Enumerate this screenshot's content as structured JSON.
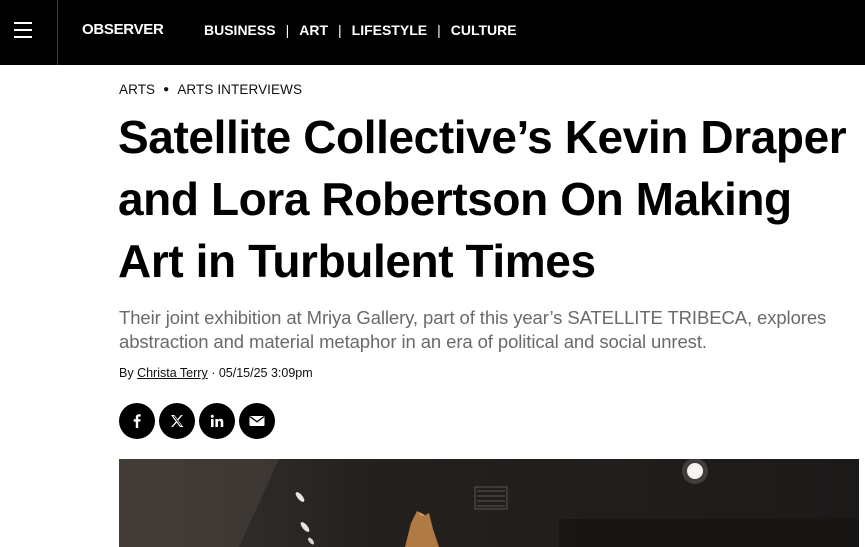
{
  "header": {
    "logo": "OBSERVER",
    "nav": [
      "BUSINESS",
      "ART",
      "LIFESTYLE",
      "CULTURE"
    ],
    "nav_separator": "|"
  },
  "breadcrumb": {
    "category": "ARTS",
    "subcategory": "ARTS INTERVIEWS"
  },
  "article": {
    "title": "Satellite Collective’s Kevin Draper and Lora Robertson On Making Art in Turbulent Times",
    "dek": "Their joint exhibition at Mriya Gallery, part of this year’s SATELLITE TRIBECA, explores abstraction and material metaphor in an era of political and social unrest.",
    "byline_prefix": "By",
    "author": "Christa Terry",
    "timestamp": "05/15/25 3:09pm"
  },
  "share": {
    "icons": [
      "facebook-icon",
      "x-icon",
      "linkedin-icon",
      "email-icon"
    ]
  },
  "colors": {
    "topbar_bg": "#000000",
    "dek_text": "#6a6a6a",
    "share_bg": "#000000"
  }
}
